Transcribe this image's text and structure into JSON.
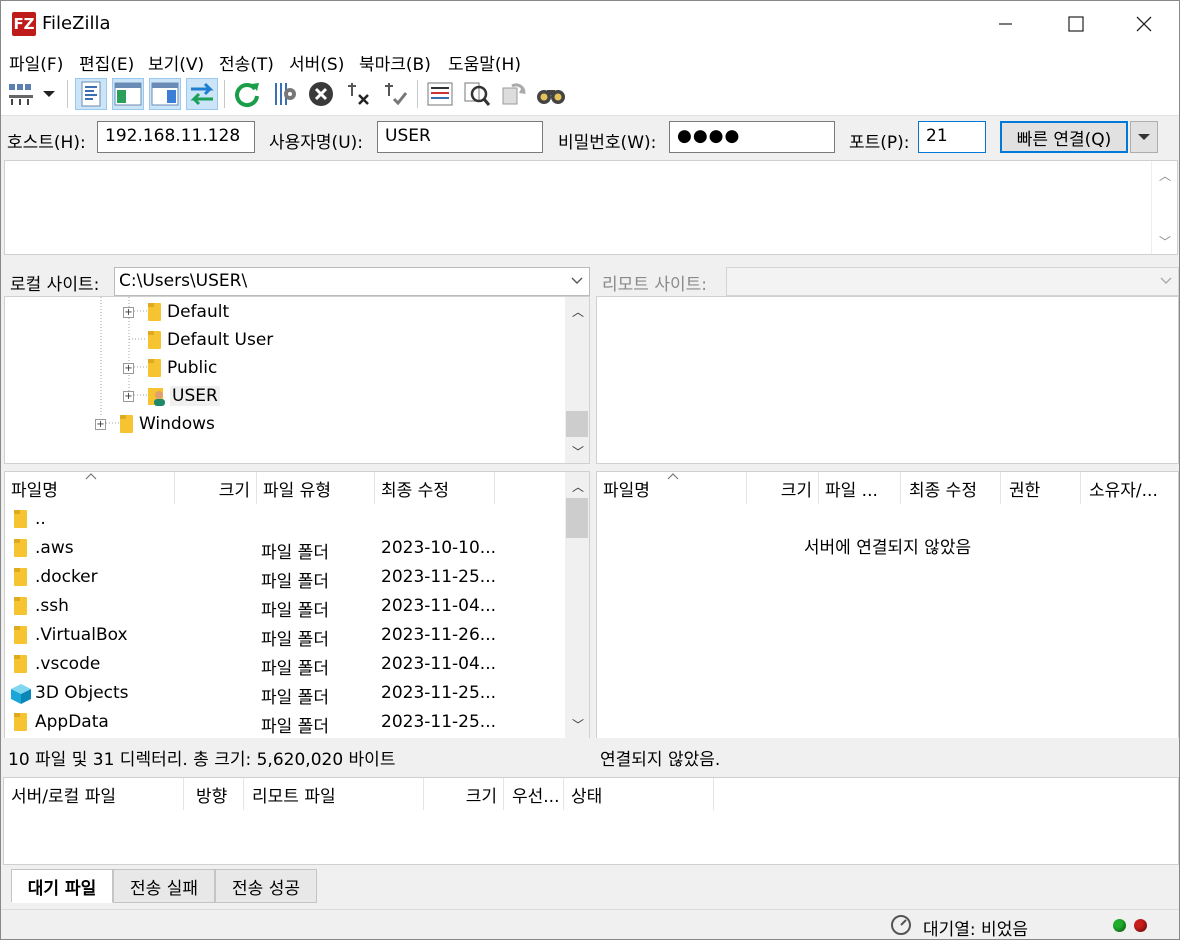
{
  "window": {
    "title": "FileZilla",
    "app_icon_text": "FZ"
  },
  "menu": [
    "파일(F)",
    "편집(E)",
    "보기(V)",
    "전송(T)",
    "서버(S)",
    "북마크(B)",
    "도움말(H)"
  ],
  "toolbar": {
    "icons": [
      "site-manager-icon",
      "site-manager-dropdown-icon",
      "message-log-icon",
      "local-tree-icon",
      "remote-tree-icon",
      "transfer-queue-icon",
      "refresh-icon",
      "process-queue-icon",
      "cancel-icon",
      "disconnect-icon",
      "reconnect-icon",
      "directory-listing-filters-icon",
      "compare-directories-icon",
      "sync-browsing-icon",
      "search-files-icon"
    ]
  },
  "quickconnect": {
    "host_label": "호스트(H):",
    "host_value": "192.168.11.128",
    "user_label": "사용자명(U):",
    "user_value": "USER",
    "pass_label": "비밀번호(W):",
    "pass_value": "●●●●",
    "port_label": "포트(P):",
    "port_value": "21",
    "connect_label": "빠른 연결(Q)"
  },
  "local": {
    "site_label": "로컬 사이트:",
    "path": "C:\\Users\\USER\\",
    "tree": [
      {
        "name": "Default",
        "expander": "+"
      },
      {
        "name": "Default User",
        "expander": ""
      },
      {
        "name": "Public",
        "expander": "+"
      },
      {
        "name": "USER",
        "expander": "+",
        "selected": true
      },
      {
        "name": "Windows",
        "expander": "+"
      }
    ],
    "columns": [
      "파일명",
      "크기",
      "파일 유형",
      "최종 수정"
    ],
    "files": [
      {
        "name": "..",
        "type": "",
        "modified": ""
      },
      {
        "name": ".aws",
        "type": "파일 폴더",
        "modified": "2023-10-10..."
      },
      {
        "name": ".docker",
        "type": "파일 폴더",
        "modified": "2023-11-25..."
      },
      {
        "name": ".ssh",
        "type": "파일 폴더",
        "modified": "2023-11-04..."
      },
      {
        "name": ".VirtualBox",
        "type": "파일 폴더",
        "modified": "2023-11-26..."
      },
      {
        "name": ".vscode",
        "type": "파일 폴더",
        "modified": "2023-11-04..."
      },
      {
        "name": "3D Objects",
        "type": "파일 폴더",
        "modified": "2023-11-25..."
      },
      {
        "name": "AppData",
        "type": "파일 폴더",
        "modified": "2023-11-25..."
      }
    ],
    "status": "10 파일 및 31 디렉터리. 총 크기: 5,620,020 바이트"
  },
  "remote": {
    "site_label": "리모트 사이트:",
    "columns": [
      "파일명",
      "크기",
      "파일 ...",
      "최종 수정",
      "권한",
      "소유자/..."
    ],
    "empty_message": "서버에 연결되지 않았음",
    "status": "연결되지 않았음."
  },
  "queue": {
    "columns": [
      "서버/로컬 파일",
      "방향",
      "리모트 파일",
      "크기",
      "우선...",
      "상태"
    ],
    "tabs": [
      "대기 파일",
      "전송 실패",
      "전송 성공"
    ]
  },
  "statusbar": {
    "queue_text": "대기열: 비었음"
  },
  "colors": {
    "accent": "#0078d7",
    "selection": "#cce4f7",
    "folder": "#f5c430",
    "led_green": "#1fae2c",
    "led_red": "#c81e1e"
  }
}
